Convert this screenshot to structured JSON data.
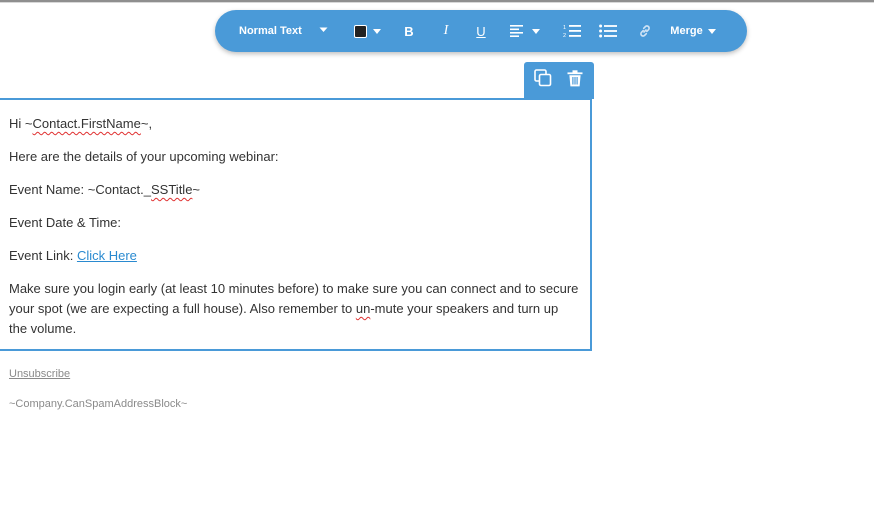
{
  "toolbar": {
    "style_label": "Normal Text",
    "text_color": "#222222",
    "bold_label": "B",
    "italic_label": "I",
    "underline_label": "U",
    "merge_label": "Merge",
    "icons": [
      "chevron-down-icon",
      "bold-icon",
      "italic-icon",
      "underline-icon",
      "align-left-icon",
      "ordered-list-icon",
      "bullet-list-icon",
      "link-icon"
    ]
  },
  "block_actions": {
    "icons": [
      "copy-icon",
      "trash-icon"
    ]
  },
  "content": {
    "greeting_prefix": "Hi ~",
    "greeting_token": "Contact.FirstName",
    "greeting_suffix": "~,",
    "intro": "Here are the details of your upcoming webinar:",
    "event_name_prefix": "Event Name: ~Contact._",
    "event_name_token": "SSTitle",
    "event_name_suffix": "~",
    "event_datetime": "Event Date & Time:",
    "event_link_label": "Event Link: ",
    "event_link_text": "Click Here",
    "paragraph_line1": "Make sure you login early (at least 10 minutes before) to make sure you can connect and to secure",
    "paragraph_line2_before": "your spot (we are expecting a full house). Also remember to ",
    "paragraph_line2_token": "un",
    "paragraph_line2_after": "-mute your speakers and turn up",
    "paragraph_line3": "the volume."
  },
  "footer": {
    "unsubscribe": "Unsubscribe",
    "address_block": "~Company.CanSpamAddressBlock~"
  },
  "colors": {
    "accent": "#4a9ad8",
    "link": "#2a8ad0",
    "spellcheck": "#e03030",
    "muted": "#8a8a8a"
  }
}
